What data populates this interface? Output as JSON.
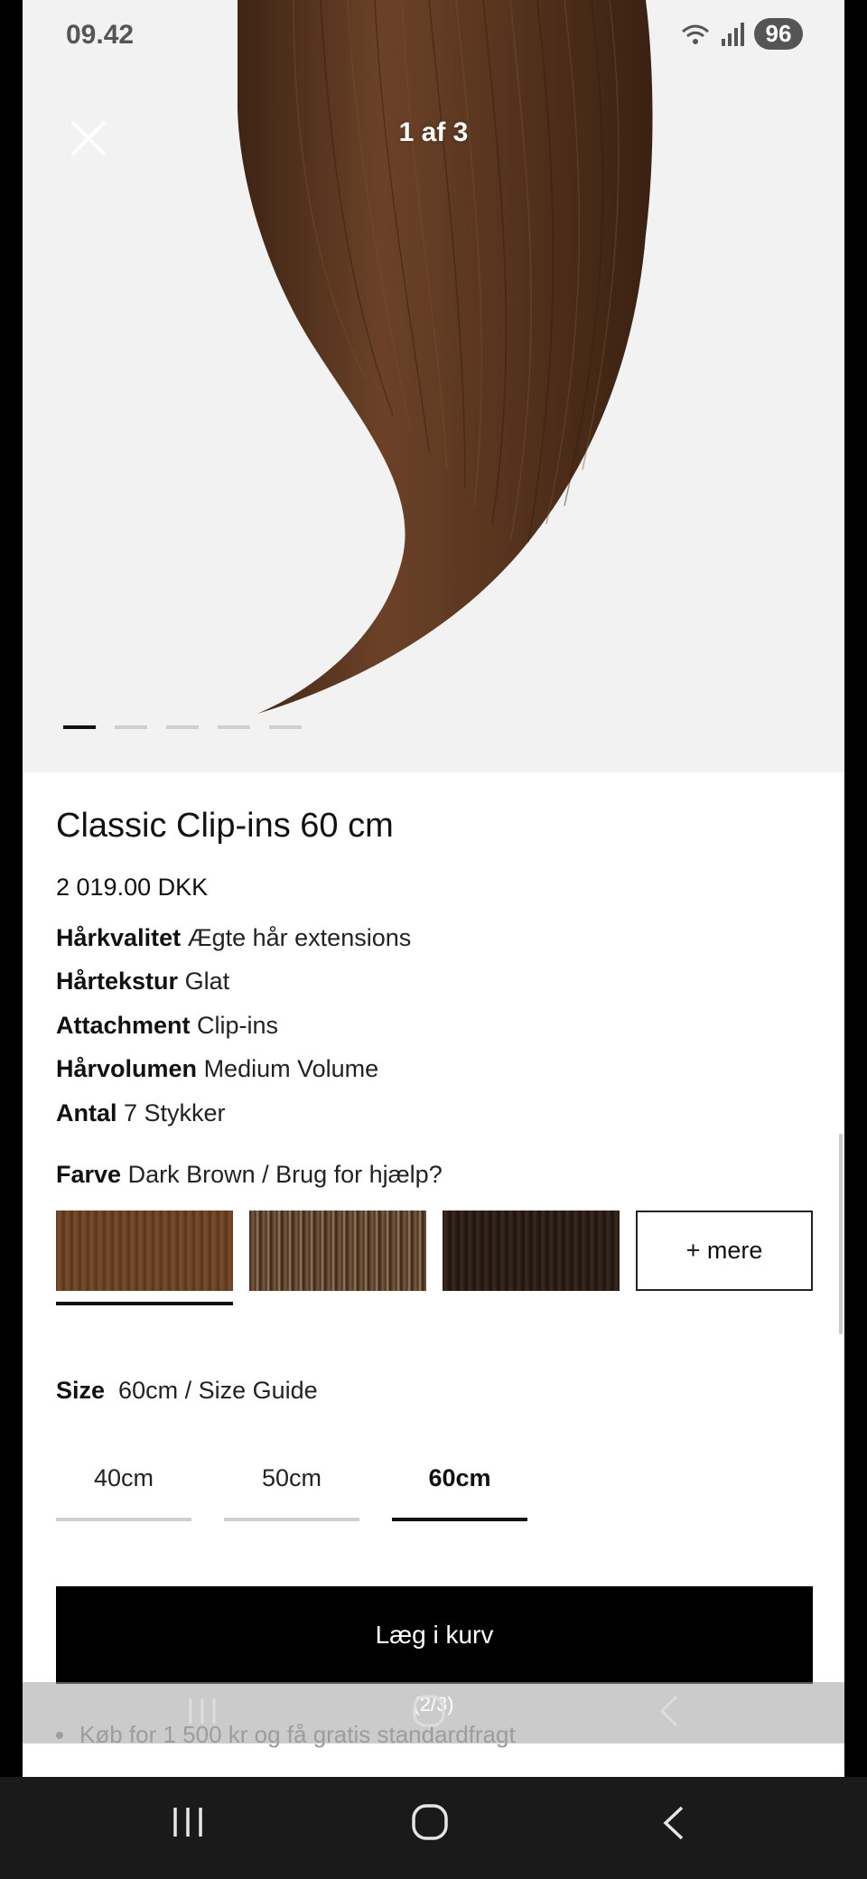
{
  "status_bar": {
    "time": "09.42",
    "battery": "96"
  },
  "gallery": {
    "counter": "1 af 3",
    "dots": 5,
    "active_dot": 0
  },
  "product": {
    "title": "Classic Clip-ins 60 cm",
    "price": "2 019.00 DKK",
    "attributes": [
      {
        "label": "Hårkvalitet",
        "value": "Ægte hår extensions"
      },
      {
        "label": "Hårtekstur",
        "value": "Glat"
      },
      {
        "label": "Attachment",
        "value": "Clip-ins"
      },
      {
        "label": "Hårvolumen",
        "value": "Medium Volume"
      },
      {
        "label": "Antal",
        "value": "7 Stykker"
      }
    ],
    "color": {
      "label": "Farve",
      "value": "Dark Brown / Brug for hjælp?"
    },
    "swatches_more": "+ mere",
    "size": {
      "label": "Size",
      "value": "60cm / Size Guide",
      "options": [
        "40cm",
        "50cm",
        "60cm"
      ],
      "selected": "60cm"
    },
    "add_to_cart": "Læg i kurv",
    "shipping_note": "Køb for 1 500 kr og få gratis standardfragt"
  },
  "overlay": {
    "page_indicator": "(2/3)"
  },
  "colors": {
    "hair_dark": "#4a2c18",
    "hair_mid": "#6b4228",
    "swatch_1": "#6b4426",
    "swatch_2": "#4a3424",
    "swatch_3": "#2a1d16"
  }
}
